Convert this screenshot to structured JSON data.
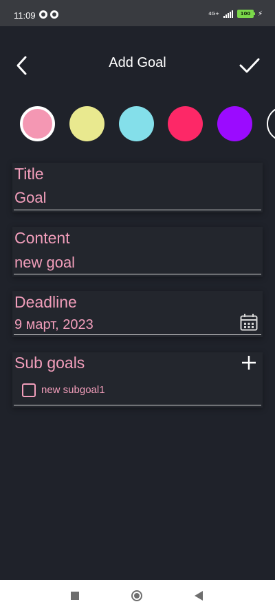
{
  "status_bar": {
    "time": "11:09",
    "network": "4G+",
    "battery": "100",
    "icons": [
      "notification-icon",
      "notification-icon",
      "signal-icon",
      "battery-icon",
      "charging-icon"
    ]
  },
  "app_bar": {
    "title": "Add Goal",
    "back_icon": "chevron-left-icon",
    "save_icon": "checkmark-icon"
  },
  "colors": {
    "swatches": [
      "#f497b3",
      "#e9e98f",
      "#84dfea",
      "#fd2867",
      "#9b0bff"
    ],
    "selected_index": 0,
    "selected_border": "#ffffff"
  },
  "form": {
    "title": {
      "label": "Title",
      "value": "Goal"
    },
    "content": {
      "label": "Content",
      "value": "new goal"
    },
    "deadline": {
      "label": "Deadline",
      "value": "9 март, 2023",
      "icon": "calendar-icon"
    },
    "subgoals": {
      "label": "Sub goals",
      "add_icon": "plus-icon",
      "items": [
        {
          "label": "new subgoal1",
          "checked": false
        }
      ]
    }
  },
  "theme": {
    "background": "#1f222a",
    "card": "#23262d",
    "accent": "#f29ebb",
    "text": "#ffffff"
  },
  "nav_bar": {
    "icons": [
      "recents-icon",
      "home-icon",
      "back-icon"
    ]
  }
}
